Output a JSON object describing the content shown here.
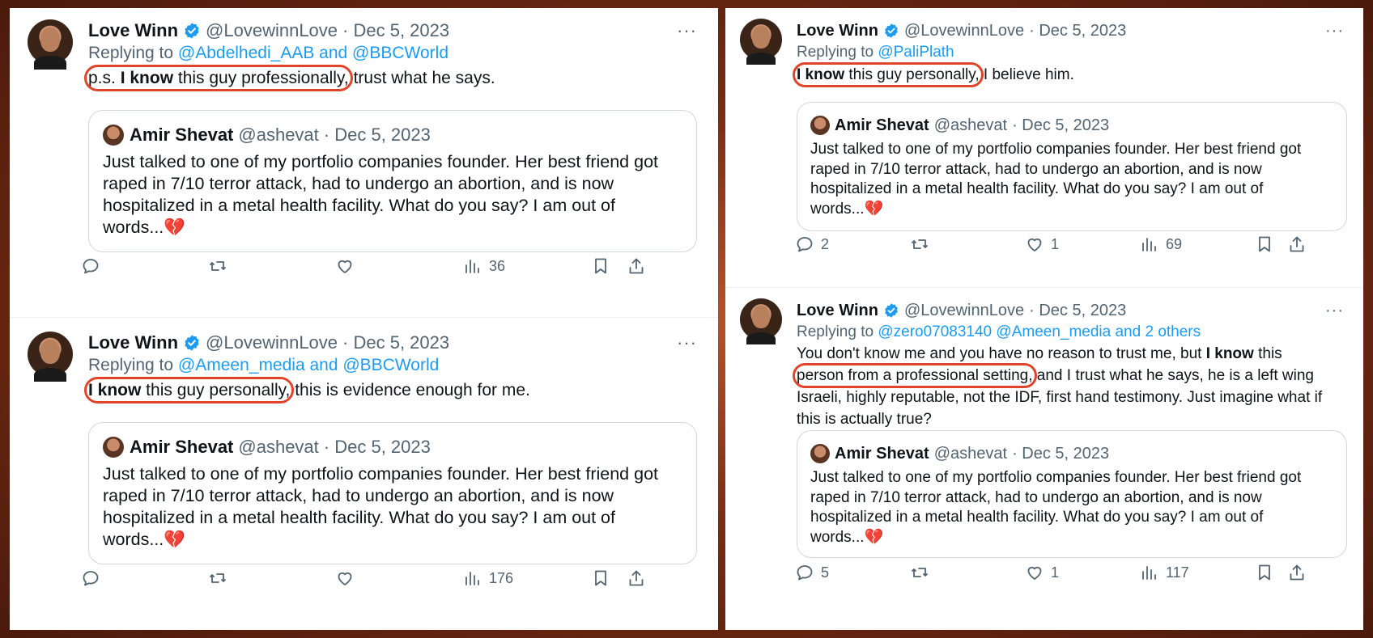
{
  "colors": {
    "link": "#1d9bf0",
    "muted": "#536471",
    "highlight": "#e0452b",
    "verified": "#1d9bf0"
  },
  "author": {
    "name": "Love Winn",
    "handle": "@LovewinnLove",
    "date": "· Dec 5, 2023"
  },
  "quoted": {
    "name": "Amir Shevat",
    "handle": "@ashevat",
    "date": "· Dec 5, 2023",
    "text": "Just talked to one of my portfolio companies founder. Her best friend got raped in 7/10 terror attack, had to undergo an abortion, and is now hospitalized in a metal health facility. What do you say? I am out of words...",
    "emoji": "💔"
  },
  "more_label": "···",
  "replying_prefix": "Replying to",
  "tweets": [
    {
      "replying_to": "@Abdelhedi_AAB and @BBCWorld",
      "highlight_a": "p.s. ",
      "highlight_bold": "I know",
      "highlight_b": " this guy professionally,",
      "rest": " trust what he says.",
      "stats": {
        "replies": "",
        "reposts": "",
        "likes": "",
        "views": "36"
      }
    },
    {
      "replying_to": "@Ameen_media and @BBCWorld",
      "highlight_bold": "I know",
      "highlight_b": " this guy personally,",
      "rest": " this is evidence enough for me.",
      "stats": {
        "replies": "",
        "reposts": "",
        "likes": "",
        "views": "176"
      }
    },
    {
      "replying_to": "@PaliPlath",
      "highlight_bold": "I know",
      "highlight_b": " this guy personally,",
      "rest": " I believe him.",
      "stats": {
        "replies": "2",
        "reposts": "",
        "likes": "1",
        "views": "69"
      }
    },
    {
      "replying_to": "@zero07083140 @Ameen_media and 2 others",
      "pre": "You don't know me and you have no reason to trust me, but ",
      "bold": "I know",
      "post": " this",
      "highlight_b": "person from a professional setting,",
      "rest": " and I trust what he says, he is a left wing Israeli, highly reputable, not the IDF, first hand testimony. Just imagine what if this is actually true?",
      "stats": {
        "replies": "5",
        "reposts": "",
        "likes": "1",
        "views": "117"
      }
    }
  ]
}
